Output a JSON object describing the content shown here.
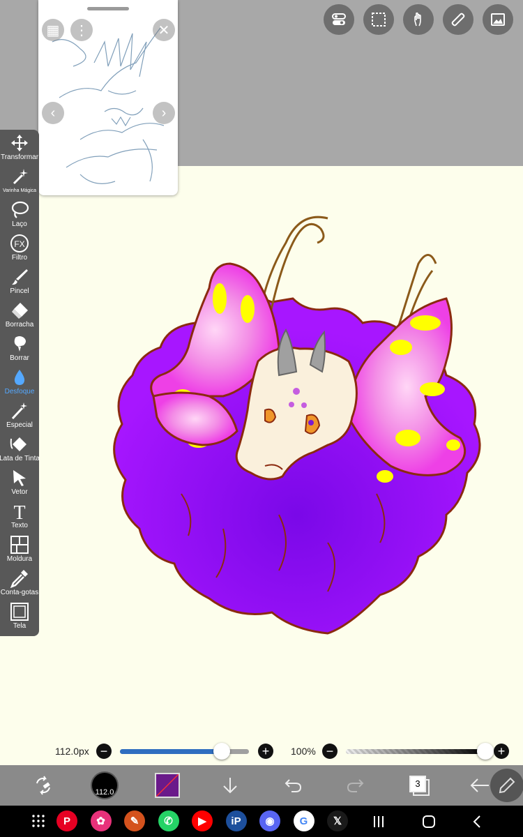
{
  "top_toolbar": {
    "icons": [
      "toggles-icon",
      "selection-icon",
      "hand-touch-icon",
      "ruler-icon",
      "image-icon"
    ]
  },
  "reference_window": {
    "icons": [
      "open-image-icon",
      "more-vertical-icon",
      "close-icon",
      "prev-arrow-icon",
      "next-arrow-icon"
    ]
  },
  "tools": [
    {
      "label": "Transformar",
      "icon": "move-arrows-icon"
    },
    {
      "label": "Varinha Mágica",
      "icon": "magic-wand-icon"
    },
    {
      "label": "Laço",
      "icon": "lasso-icon"
    },
    {
      "label": "Filtro",
      "icon": "fx-icon",
      "glyph": "FX"
    },
    {
      "label": "Pincel",
      "icon": "brush-icon"
    },
    {
      "label": "Borracha",
      "icon": "eraser-icon"
    },
    {
      "label": "Borrar",
      "icon": "smudge-icon"
    },
    {
      "label": "Desfoque",
      "icon": "blur-drop-icon",
      "active": true
    },
    {
      "label": "Especial",
      "icon": "special-brush-icon"
    },
    {
      "label": "Lata de Tinta",
      "icon": "paint-bucket-icon"
    },
    {
      "label": "Vetor",
      "icon": "vector-cursor-icon"
    },
    {
      "label": "Texto",
      "icon": "text-icon",
      "glyph": "T"
    },
    {
      "label": "Moldura",
      "icon": "frame-divider-icon"
    },
    {
      "label": "Conta-gotas",
      "icon": "eyedropper-icon"
    },
    {
      "label": "Tela",
      "icon": "canvas-icon"
    }
  ],
  "brush_size": {
    "text": "112.0px",
    "value_fraction": 0.79,
    "minus": "−",
    "plus": "+"
  },
  "opacity": {
    "text": "100%",
    "value_fraction": 1.0,
    "minus": "−",
    "plus": "+"
  },
  "bottom_bar": {
    "brush_preview_label": "112.0",
    "color_swatch": "#6a1a8a",
    "layers_count": "3",
    "icons": [
      "transform-swap-icon",
      "brush-size-preview",
      "color-swatch",
      "download-arrow-icon",
      "undo-icon",
      "redo-icon",
      "layers-icon",
      "back-arrow-icon",
      "pencil-icon"
    ]
  },
  "nav": {
    "apps": [
      {
        "name": "pinterest-icon",
        "glyph": "P",
        "color": "#e60023"
      },
      {
        "name": "blossom-app-icon",
        "glyph": "✿",
        "color": "#e8317a"
      },
      {
        "name": "sketch-app-icon",
        "glyph": "✎",
        "color": "#d4521d"
      },
      {
        "name": "whatsapp-icon",
        "glyph": "✆",
        "color": "#25d366"
      },
      {
        "name": "youtube-icon",
        "glyph": "▶",
        "color": "#ff0000"
      },
      {
        "name": "ibispaint-icon",
        "glyph": "iP",
        "color": "#1d4f9c"
      },
      {
        "name": "discord-icon",
        "glyph": "◉",
        "color": "#5865f2"
      },
      {
        "name": "google-icon",
        "glyph": "G",
        "color": "#ffffff"
      },
      {
        "name": "x-icon",
        "glyph": "𝕏",
        "color": "#1a1a1a"
      }
    ],
    "system_icons": [
      "recents-icon",
      "home-icon",
      "back-icon"
    ]
  },
  "colors": {
    "purple": "#9a0cff",
    "pink": "#f06be0",
    "yellow": "#ffff00",
    "outline": "#8b2a10",
    "canvas": "#fdfeec",
    "slider_blue": "#2f6ec0"
  }
}
